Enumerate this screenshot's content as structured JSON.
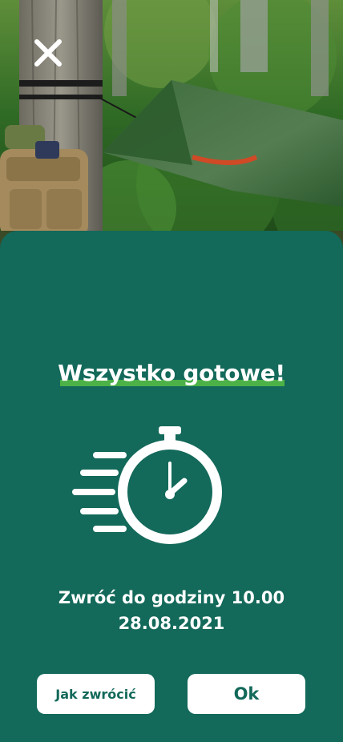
{
  "hero": {
    "close_icon": "close-icon",
    "image_subject": "forest-camp-photo"
  },
  "sheet": {
    "title": "Wszystko gotowe!",
    "icon": "stopwatch-icon",
    "return_line1": "Zwróć do godziny 10.00",
    "return_line2": "28.08.2021",
    "how_to_return_label": "Jak zwrócić",
    "ok_label": "Ok"
  },
  "colors": {
    "background": "#13695a",
    "accent_underline": "#4cb147",
    "button_bg": "#ffffff",
    "button_text": "#13695a"
  }
}
